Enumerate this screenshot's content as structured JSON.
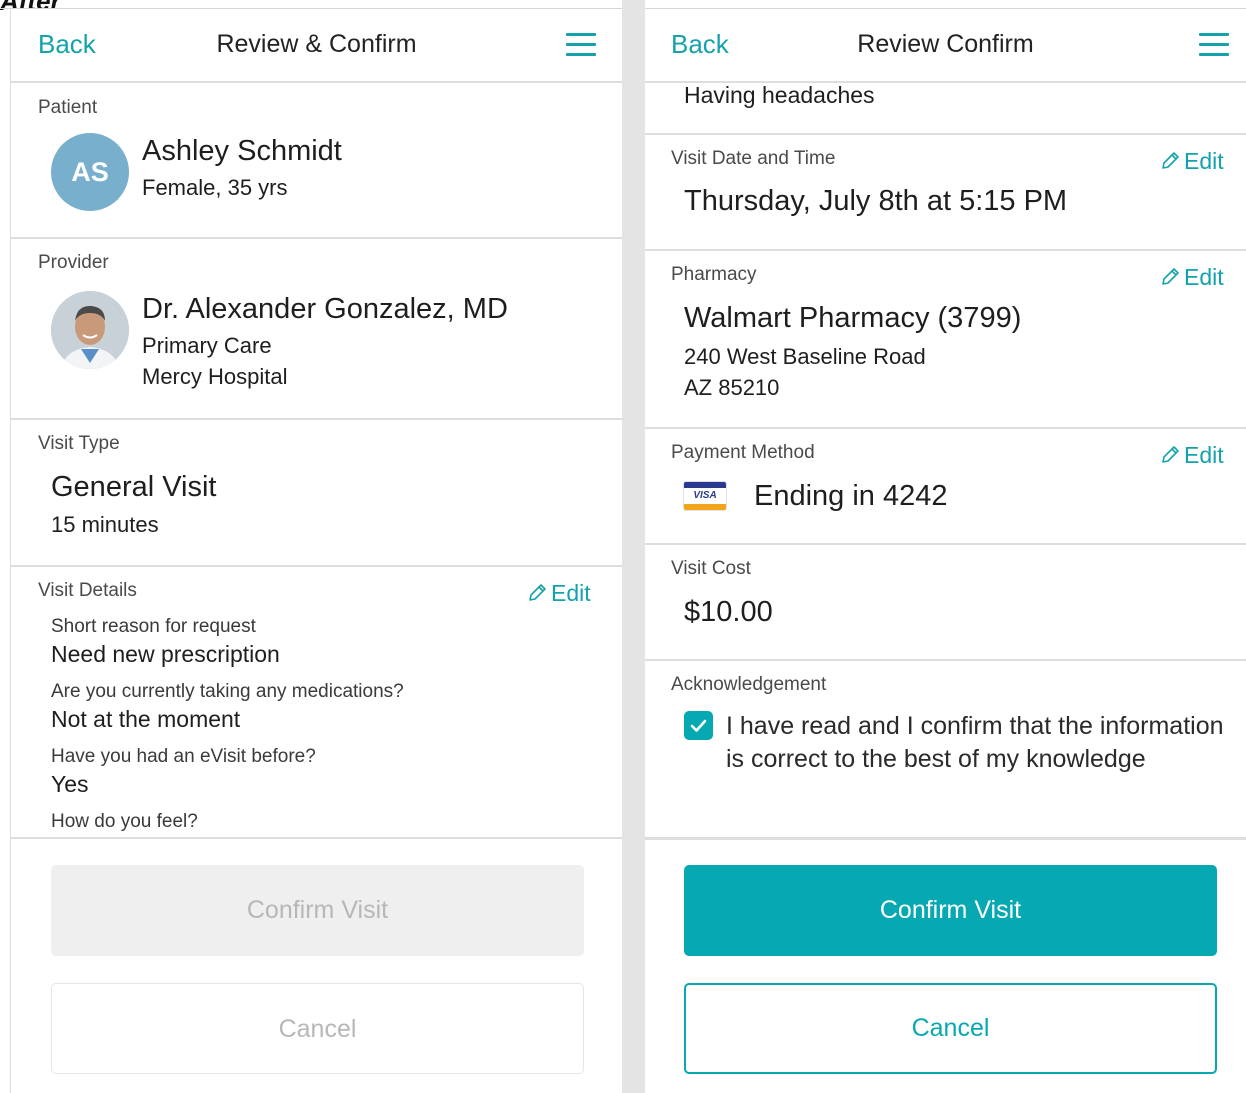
{
  "page_tag": "After",
  "left": {
    "header": {
      "back": "Back",
      "title": "Review & Confirm",
      "menu_icon": "hamburger-icon"
    },
    "patient": {
      "label": "Patient",
      "initials": "AS",
      "name": "Ashley Schmidt",
      "meta": "Female, 35 yrs"
    },
    "provider": {
      "label": "Provider",
      "name": "Dr. Alexander Gonzalez, MD",
      "specialty": "Primary Care",
      "hospital": "Mercy Hospital"
    },
    "visit_type": {
      "label": "Visit Type",
      "name": "General Visit",
      "duration": "15 minutes"
    },
    "visit_details": {
      "label": "Visit Details",
      "edit": "Edit",
      "items": [
        {
          "q": "Short reason for request",
          "a": "Need new prescription"
        },
        {
          "q": "Are you currently taking any medications?",
          "a": "Not at the moment"
        },
        {
          "q": "Have you had an eVisit before?",
          "a": "Yes"
        },
        {
          "q": "How do you feel?",
          "a": ""
        }
      ]
    },
    "footer": {
      "confirm": "Confirm Visit",
      "cancel": "Cancel"
    }
  },
  "right": {
    "header": {
      "back": "Back",
      "title": "Review Confirm",
      "menu_icon": "hamburger-icon"
    },
    "feel_answer": "Having headaches",
    "date_time": {
      "label": "Visit Date and Time",
      "edit": "Edit",
      "value": "Thursday, July 8th at 5:15 PM"
    },
    "pharmacy": {
      "label": "Pharmacy",
      "edit": "Edit",
      "name": "Walmart Pharmacy (3799)",
      "address1": "240 West Baseline Road",
      "address2": "AZ 85210"
    },
    "payment": {
      "label": "Payment Method",
      "edit": "Edit",
      "card_brand": "VISA",
      "value": "Ending in 4242"
    },
    "cost": {
      "label": "Visit Cost",
      "value": "$10.00"
    },
    "ack": {
      "label": "Acknowledgement",
      "text": "I have read and I confirm that the information is correct to the best of my knowledge",
      "checked": true
    },
    "footer": {
      "confirm": "Confirm Visit",
      "cancel": "Cancel"
    }
  },
  "colors": {
    "accent": "#06a9b1",
    "link": "#14a3ad",
    "avatar": "#78afcc",
    "divider": "#dedede"
  }
}
